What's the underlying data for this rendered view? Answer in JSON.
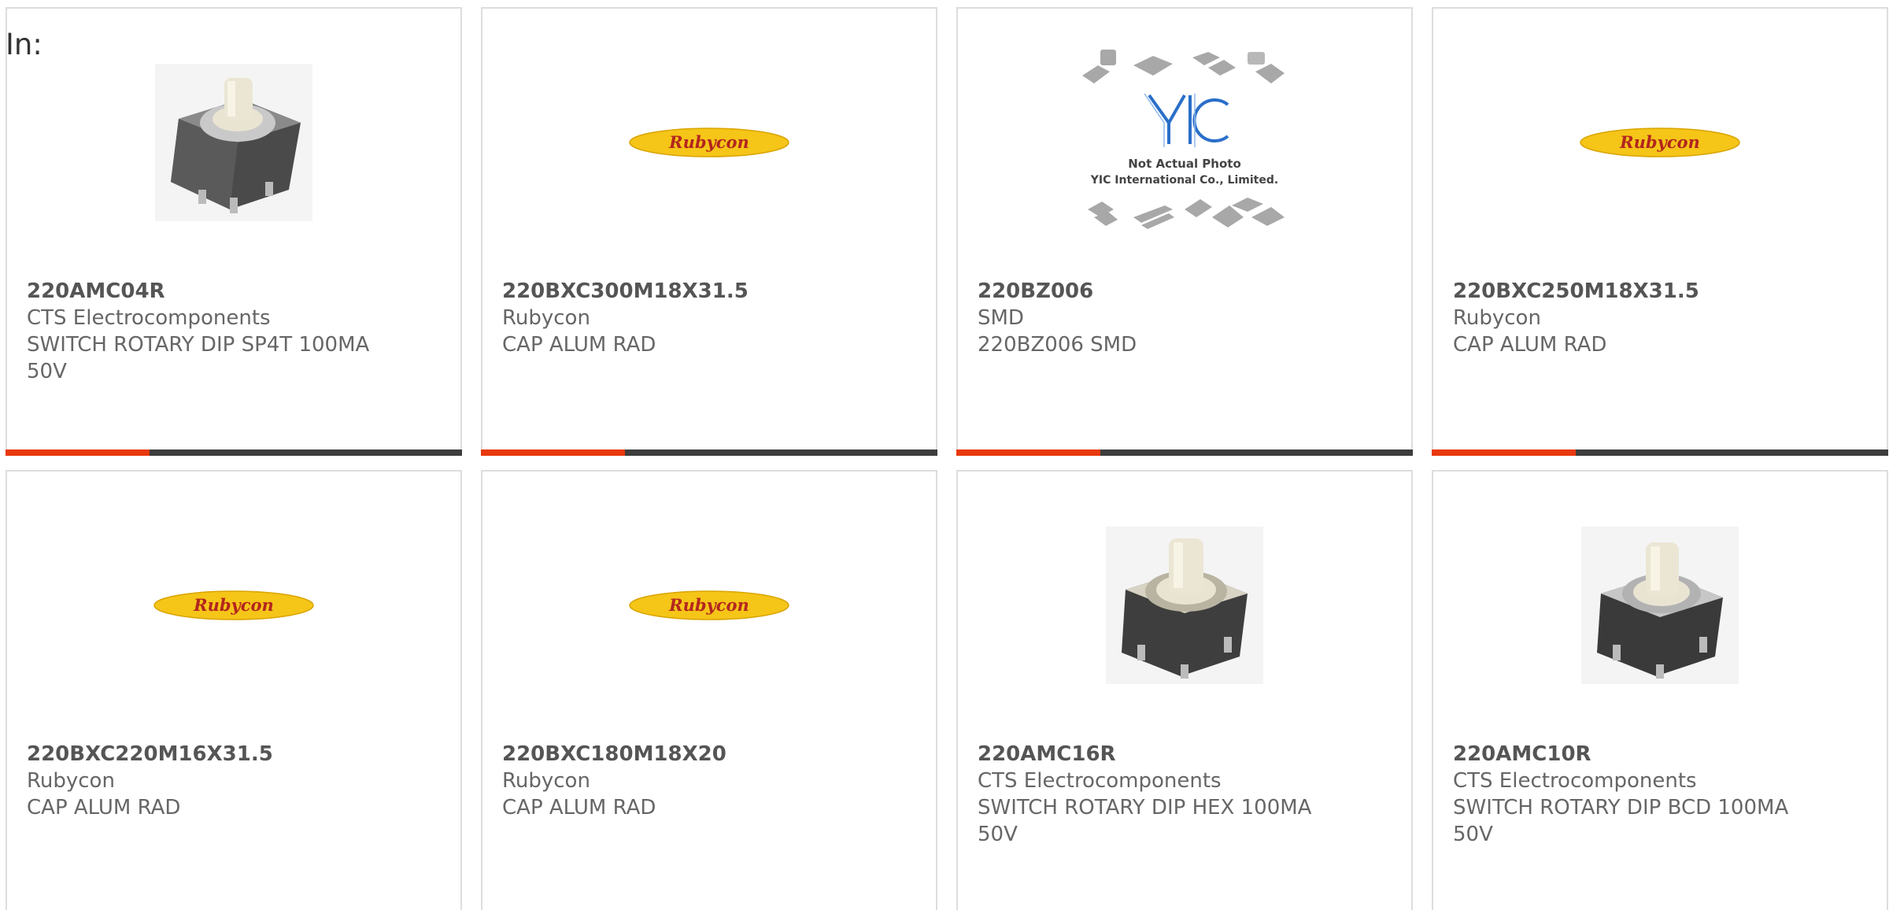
{
  "header": {
    "label": "In:"
  },
  "colors": {
    "accent": "#e8380d",
    "bar": "#3d3d3d",
    "border": "#dddddd",
    "rubycon_yellow": "#f5c518",
    "rubycon_red": "#b3261e"
  },
  "products": [
    {
      "part_number": "220AMC04R",
      "manufacturer": "CTS Electrocomponents",
      "description": "SWITCH ROTARY DIP SP4T 100MA 50V",
      "image": "rotary-switch-image"
    },
    {
      "part_number": "220BXC300M18X31.5",
      "manufacturer": "Rubycon",
      "description": "CAP ALUM RAD",
      "image": "rubycon-logo",
      "logo_text": "Rubycon"
    },
    {
      "part_number": "220BZ006",
      "manufacturer": "SMD",
      "description": "220BZ006 SMD",
      "image": "yic-placeholder",
      "logo_line1": "Not Actual Photo",
      "logo_line2": "YIC International Co., Limited."
    },
    {
      "part_number": "220BXC250M18X31.5",
      "manufacturer": "Rubycon",
      "description": "CAP ALUM RAD",
      "image": "rubycon-logo",
      "logo_text": "Rubycon"
    },
    {
      "part_number": "220BXC220M16X31.5",
      "manufacturer": "Rubycon",
      "description": "CAP ALUM RAD",
      "image": "rubycon-logo",
      "logo_text": "Rubycon"
    },
    {
      "part_number": "220BXC180M18X20",
      "manufacturer": "Rubycon",
      "description": "CAP ALUM RAD",
      "image": "rubycon-logo",
      "logo_text": "Rubycon"
    },
    {
      "part_number": "220AMC16R",
      "manufacturer": "CTS Electrocomponents",
      "description": "SWITCH ROTARY DIP HEX 100MA 50V",
      "image": "rotary-switch-image"
    },
    {
      "part_number": "220AMC10R",
      "manufacturer": "CTS Electrocomponents",
      "description": "SWITCH ROTARY DIP BCD 100MA 50V",
      "image": "rotary-switch-image"
    }
  ]
}
